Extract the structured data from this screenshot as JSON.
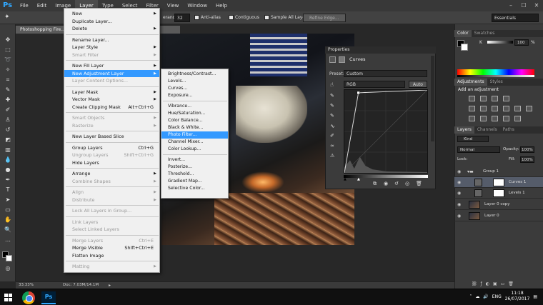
{
  "app": {
    "logo": "Ps"
  },
  "menubar": [
    "File",
    "Edit",
    "Image",
    "Layer",
    "Type",
    "Select",
    "Filter",
    "View",
    "Window",
    "Help"
  ],
  "window_controls": [
    "–",
    "☐",
    "✕"
  ],
  "options": {
    "tolerance_label": "erance:",
    "tolerance_value": "32",
    "anti_alias": "Anti-alias",
    "contiguous": "Contiguous",
    "sample_all": "Sample All Layers",
    "refine": "Refine Edge...",
    "workspace": "Essentials"
  },
  "document": {
    "tab": "Photoshopping Fire...",
    "zoom": "33.33%",
    "doc_size": "Doc: 7.03M/14.1M"
  },
  "layer_menu": [
    {
      "label": "New",
      "arrow": true
    },
    {
      "label": "Duplicate Layer..."
    },
    {
      "label": "Delete",
      "arrow": true
    },
    {
      "sep": true
    },
    {
      "label": "Rename Layer..."
    },
    {
      "label": "Layer Style",
      "arrow": true
    },
    {
      "label": "Smart Filter",
      "disabled": true,
      "arrow": true
    },
    {
      "sep": true
    },
    {
      "label": "New Fill Layer",
      "arrow": true
    },
    {
      "label": "New Adjustment Layer",
      "arrow": true,
      "highlight": true
    },
    {
      "label": "Layer Content Options...",
      "disabled": true
    },
    {
      "sep": true
    },
    {
      "label": "Layer Mask",
      "arrow": true
    },
    {
      "label": "Vector Mask",
      "arrow": true
    },
    {
      "label": "Create Clipping Mask",
      "shortcut": "Alt+Ctrl+G"
    },
    {
      "sep": true
    },
    {
      "label": "Smart Objects",
      "disabled": true,
      "arrow": true
    },
    {
      "label": "Rasterize",
      "disabled": true,
      "arrow": true
    },
    {
      "sep": true
    },
    {
      "label": "New Layer Based Slice"
    },
    {
      "sep": true
    },
    {
      "label": "Group Layers",
      "shortcut": "Ctrl+G"
    },
    {
      "label": "Ungroup Layers",
      "shortcut": "Shift+Ctrl+G",
      "disabled": true
    },
    {
      "label": "Hide Layers"
    },
    {
      "sep": true
    },
    {
      "label": "Arrange",
      "arrow": true
    },
    {
      "label": "Combine Shapes",
      "disabled": true,
      "arrow": true
    },
    {
      "sep": true
    },
    {
      "label": "Align",
      "disabled": true,
      "arrow": true
    },
    {
      "label": "Distribute",
      "disabled": true,
      "arrow": true
    },
    {
      "sep": true
    },
    {
      "label": "Lock All Layers in Group...",
      "disabled": true
    },
    {
      "sep": true
    },
    {
      "label": "Link Layers",
      "disabled": true
    },
    {
      "label": "Select Linked Layers",
      "disabled": true
    },
    {
      "sep": true
    },
    {
      "label": "Merge Layers",
      "shortcut": "Ctrl+E",
      "disabled": true
    },
    {
      "label": "Merge Visible",
      "shortcut": "Shift+Ctrl+E"
    },
    {
      "label": "Flatten Image"
    },
    {
      "sep": true
    },
    {
      "label": "Matting",
      "disabled": true,
      "arrow": true
    }
  ],
  "adjustment_submenu": [
    {
      "label": "Brightness/Contrast..."
    },
    {
      "label": "Levels..."
    },
    {
      "label": "Curves..."
    },
    {
      "label": "Exposure..."
    },
    {
      "sep": true
    },
    {
      "label": "Vibrance..."
    },
    {
      "label": "Hue/Saturation..."
    },
    {
      "label": "Color Balance..."
    },
    {
      "label": "Black & White..."
    },
    {
      "label": "Photo Filter...",
      "highlight": true
    },
    {
      "label": "Channel Mixer..."
    },
    {
      "label": "Color Lookup..."
    },
    {
      "sep": true
    },
    {
      "label": "Invert..."
    },
    {
      "label": "Posterize..."
    },
    {
      "label": "Threshold..."
    },
    {
      "label": "Gradient Map..."
    },
    {
      "label": "Selective Color..."
    }
  ],
  "properties": {
    "tab": "Properties",
    "title": "Curves",
    "preset_label": "Preset:",
    "preset_value": "Custom",
    "channel": "RGB",
    "auto": "Auto"
  },
  "color_panel": {
    "tabs": [
      "Color",
      "Swatches"
    ],
    "k_label": "K",
    "k_value": "100",
    "unit": "%"
  },
  "adjustments_panel": {
    "tabs": [
      "Adjustments",
      "Styles"
    ],
    "heading": "Add an adjustment"
  },
  "layers_panel": {
    "tabs": [
      "Layers",
      "Channels",
      "Paths"
    ],
    "kind": "Kind",
    "blend": "Normal",
    "opacity_label": "Opacity:",
    "opacity": "100%",
    "lock_label": "Lock:",
    "fill_label": "Fill:",
    "fill": "100%",
    "layers": [
      "Group 1",
      "Curves 1",
      "Levels 1",
      "Layer 0 copy",
      "Layer 0"
    ]
  },
  "taskbar": {
    "lang": "ENG",
    "time": "11:18",
    "date": "26/07/2017"
  },
  "colors": {
    "highlight": "#3399ff",
    "ps_blue": "#31a8ff"
  }
}
